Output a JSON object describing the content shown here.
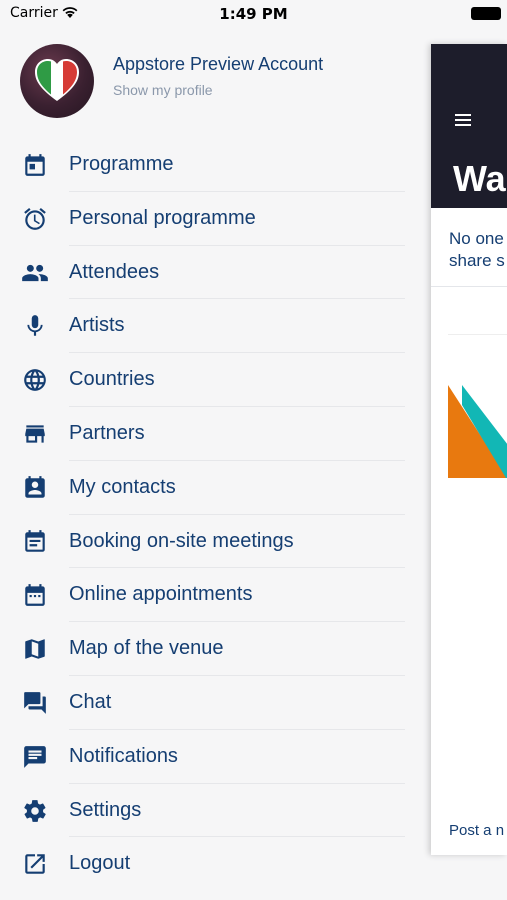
{
  "status_bar": {
    "carrier": "Carrier",
    "time": "1:49 PM"
  },
  "profile": {
    "name": "Appstore Preview Account",
    "subtitle": "Show my profile",
    "avatar_icon": "heart-italian-flag-icon"
  },
  "menu": {
    "items": [
      {
        "label": "Programme",
        "icon": "calendar-icon"
      },
      {
        "label": "Personal programme",
        "icon": "alarm-clock-icon"
      },
      {
        "label": "Attendees",
        "icon": "people-icon"
      },
      {
        "label": "Artists",
        "icon": "microphone-icon"
      },
      {
        "label": "Countries",
        "icon": "globe-icon"
      },
      {
        "label": "Partners",
        "icon": "store-icon"
      },
      {
        "label": "My contacts",
        "icon": "contact-card-icon"
      },
      {
        "label": "Booking on-site meetings",
        "icon": "event-note-icon"
      },
      {
        "label": "Online appointments",
        "icon": "calendar-dots-icon"
      },
      {
        "label": "Map of the venue",
        "icon": "map-icon"
      },
      {
        "label": "Chat",
        "icon": "chat-bubbles-icon"
      },
      {
        "label": "Notifications",
        "icon": "message-icon"
      },
      {
        "label": "Settings",
        "icon": "gear-icon"
      },
      {
        "label": "Logout",
        "icon": "logout-icon"
      }
    ]
  },
  "background_panel": {
    "title": "Wa",
    "text_line1": "No one",
    "text_line2": "share s",
    "footer": "Post a n"
  },
  "colors": {
    "accent": "#153e72",
    "muted": "#8b98ab",
    "menu_background": "#f6f6f7",
    "panel_header": "#1d1d2b"
  }
}
